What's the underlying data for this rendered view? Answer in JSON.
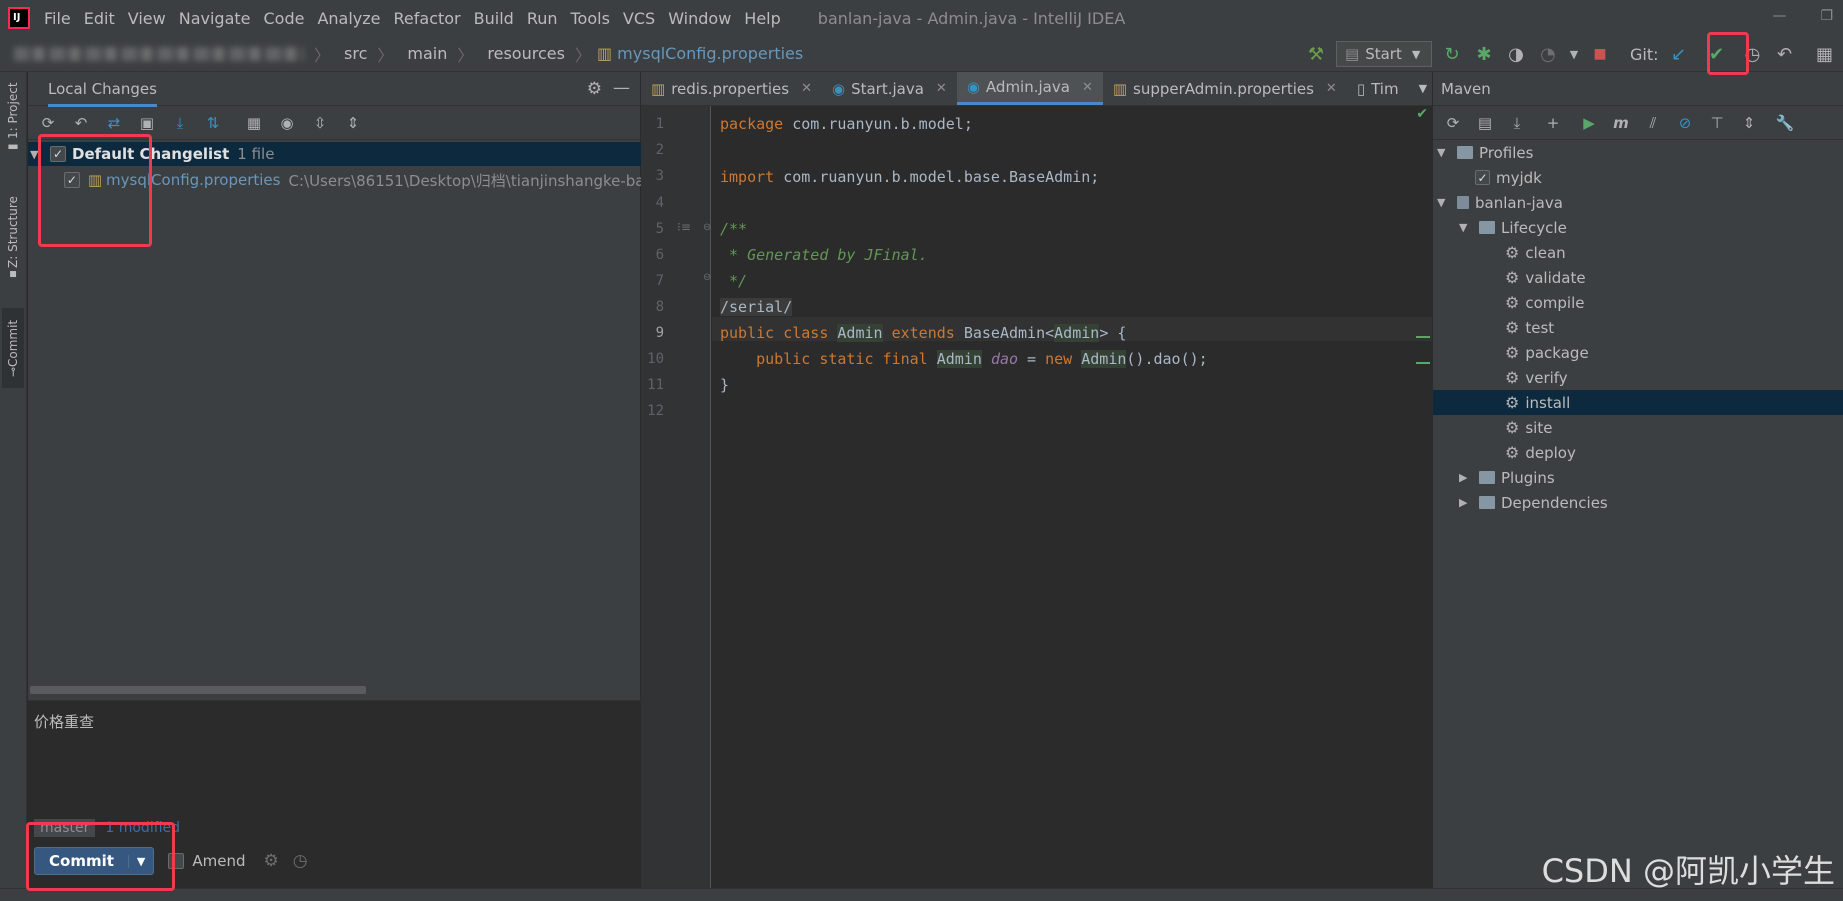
{
  "menubar": {
    "items": [
      "File",
      "Edit",
      "View",
      "Navigate",
      "Code",
      "Analyze",
      "Refactor",
      "Build",
      "Run",
      "Tools",
      "VCS",
      "Window",
      "Help"
    ],
    "window_title": "banlan-java - Admin.java - IntelliJ IDEA"
  },
  "navbar": {
    "breadcrumbs": [
      "src",
      "main",
      "resources",
      "mysqlConfig.properties"
    ],
    "run_config": "Start",
    "git_label": "Git:"
  },
  "left_stripe": {
    "project": "1: Project",
    "structure": "Z: Structure",
    "commit": "Commit"
  },
  "local_changes": {
    "title": "Local Changes",
    "changelist_name": "Default Changelist",
    "changelist_count": "1 file",
    "file_name": "mysqlConfig.properties",
    "file_path": "C:\\Users\\86151\\Desktop\\归档\\tianjinshangke-ba",
    "commit_message": "价格重查",
    "branch": "master",
    "modified": "1 modified",
    "commit_label": "Commit",
    "amend_label": "Amend"
  },
  "editor": {
    "tabs": [
      {
        "label": "redis.properties",
        "icon": "properties-file-icon"
      },
      {
        "label": "Start.java",
        "icon": "java-class-icon"
      },
      {
        "label": "Admin.java",
        "icon": "java-class-icon",
        "active": true
      },
      {
        "label": "supperAdmin.properties",
        "icon": "properties-file-icon"
      },
      {
        "label": "Tim",
        "icon": "text-file-icon"
      }
    ],
    "line_numbers": [
      "1",
      "2",
      "3",
      "4",
      "5",
      "6",
      "7",
      "8",
      "9",
      "10",
      "11",
      "12"
    ],
    "code": {
      "l1_kw": "package",
      "l1_rest": " com.ruanyun.b.model;",
      "l3_kw": "import",
      "l3_rest": " com.ruanyun.b.model.base.BaseAdmin;",
      "l5": "/**",
      "l6": " * Generated by JFinal.",
      "l7": " */",
      "l8": "/serial/",
      "l9_kw1": "public class",
      "l9_t1": "Admin",
      "l9_kw2": "extends",
      "l9_t2": "BaseAdmin<",
      "l9_t3": "Admin",
      "l9_t4": "> {",
      "l10_kw": "public static final",
      "l10_t1": "Admin",
      "l10_f": "dao",
      "l10_eq": " = ",
      "l10_new": "new",
      "l10_t2": "Admin",
      "l10_rest": "().dao();",
      "l11": "}"
    }
  },
  "maven": {
    "title": "Maven",
    "profiles": "Profiles",
    "profile_item": "myjdk",
    "project": "banlan-java",
    "lifecycle": "Lifecycle",
    "phases": [
      "clean",
      "validate",
      "compile",
      "test",
      "package",
      "verify",
      "install",
      "site",
      "deploy"
    ],
    "selected_phase": "install",
    "plugins": "Plugins",
    "dependencies": "Dependencies"
  },
  "watermark": "CSDN @阿凯小学生",
  "colors": {
    "accent": "#4a88c7",
    "highlight_box": "#f03a4f",
    "keyword": "#cc7832",
    "comment": "#629755",
    "selection": "#0d293e"
  }
}
